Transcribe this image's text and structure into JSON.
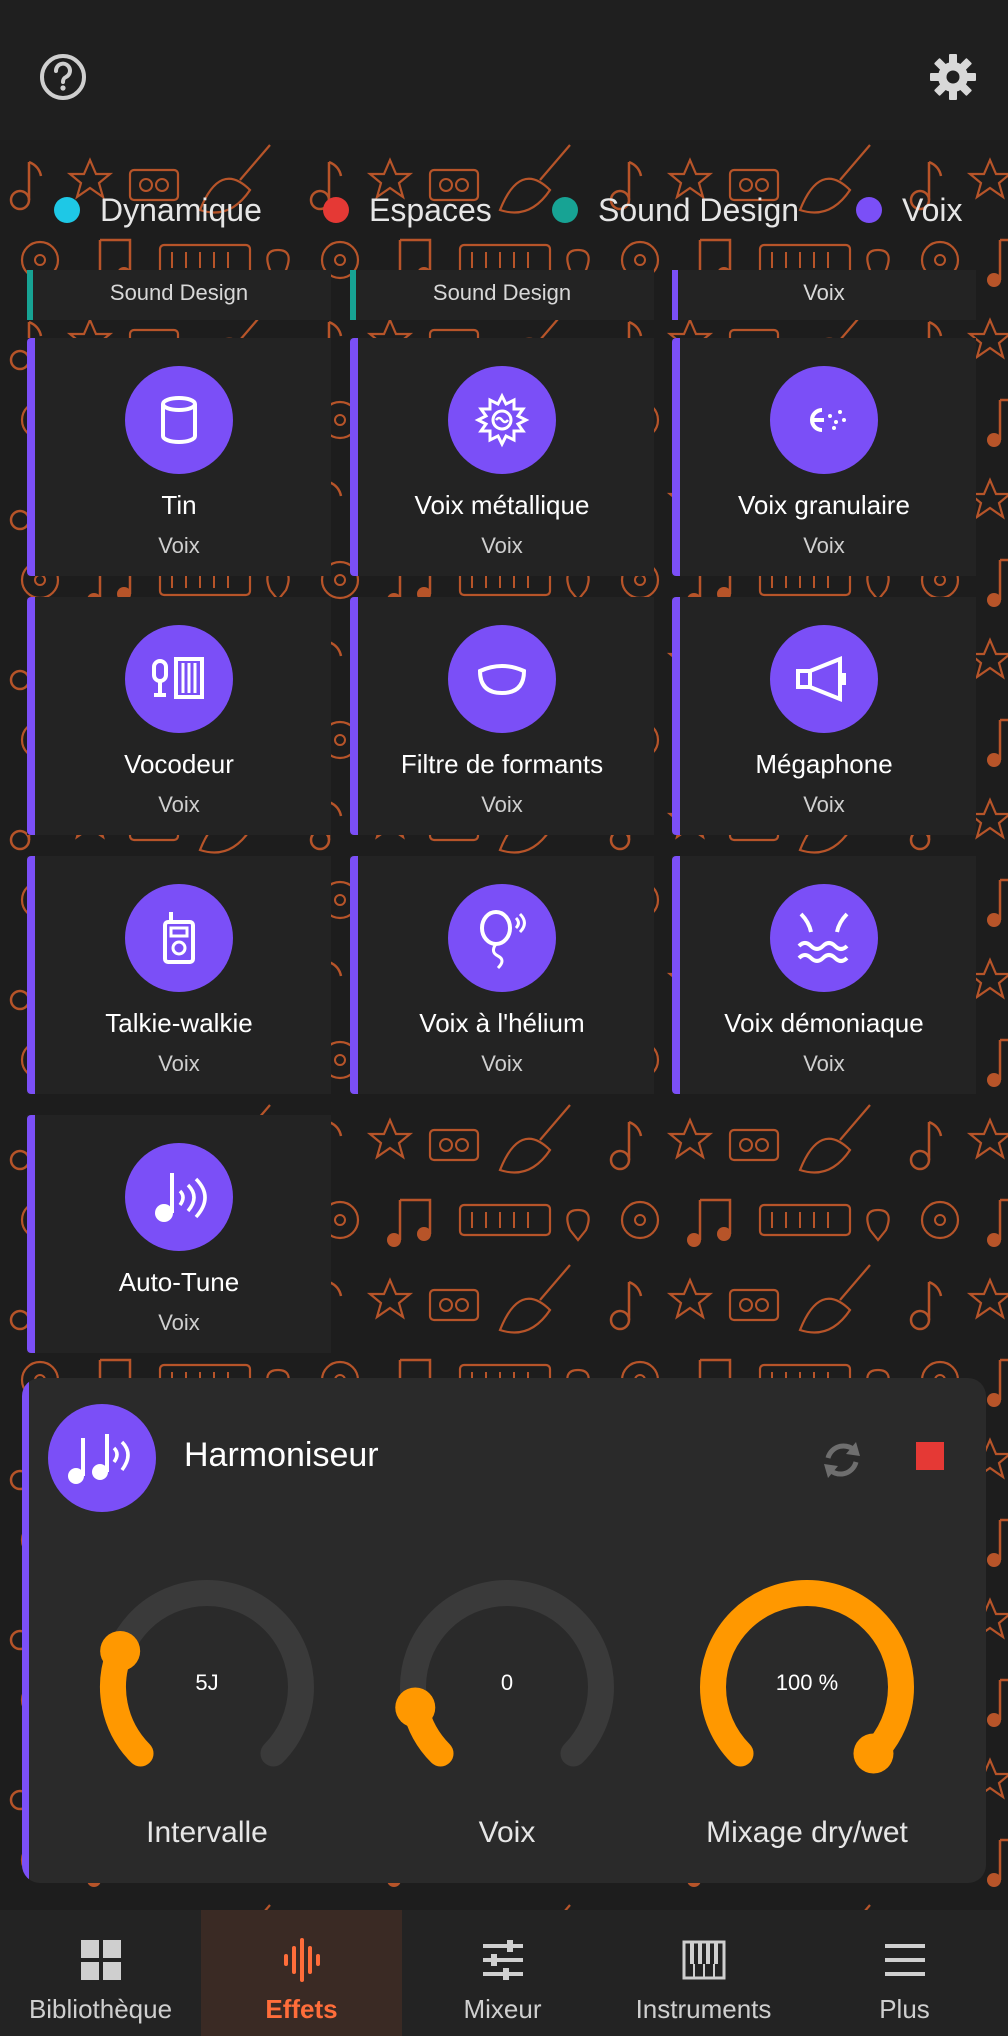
{
  "filters": [
    {
      "label": "Dynamique",
      "color": "#1ec8e6"
    },
    {
      "label": "Espaces",
      "color": "#e53935"
    },
    {
      "label": "Sound Design",
      "color": "#17a394"
    },
    {
      "label": "Voix",
      "color": "#7b4ff7"
    }
  ],
  "partial_cards": [
    {
      "label": "Sound Design",
      "color": "#17a394"
    },
    {
      "label": "Sound Design",
      "color": "#17a394"
    },
    {
      "label": "Voix",
      "color": "#7b4ff7"
    }
  ],
  "effects": [
    {
      "title": "Tin",
      "category": "Voix",
      "icon": "tin-can-icon"
    },
    {
      "title": "Voix métallique",
      "category": "Voix",
      "icon": "metallic-gear-icon"
    },
    {
      "title": "Voix granulaire",
      "category": "Voix",
      "icon": "granular-icon"
    },
    {
      "title": "Vocodeur",
      "category": "Voix",
      "icon": "vocoder-icon"
    },
    {
      "title": "Filtre de formants",
      "category": "Voix",
      "icon": "mouth-icon"
    },
    {
      "title": "Mégaphone",
      "category": "Voix",
      "icon": "megaphone-icon"
    },
    {
      "title": "Talkie-walkie",
      "category": "Voix",
      "icon": "walkie-talkie-icon"
    },
    {
      "title": "Voix à l'hélium",
      "category": "Voix",
      "icon": "balloon-icon"
    },
    {
      "title": "Voix démoniaque",
      "category": "Voix",
      "icon": "demon-face-icon"
    },
    {
      "title": "Auto-Tune",
      "category": "Voix",
      "icon": "autotune-note-icon"
    }
  ],
  "panel": {
    "title": "Harmoniseur",
    "icon": "harmonizer-notes-icon",
    "knobs": [
      {
        "label": "Intervalle",
        "value": "5J",
        "fraction": 0.25
      },
      {
        "label": "Voix",
        "value": "0",
        "fraction": 0.12
      },
      {
        "label": "Mixage dry/wet",
        "value": "100 %",
        "fraction": 1.0
      }
    ]
  },
  "nav": [
    {
      "label": "Bibliothèque",
      "icon": "library-grid-icon",
      "active": false
    },
    {
      "label": "Effets",
      "icon": "effects-waveform-icon",
      "active": true
    },
    {
      "label": "Mixeur",
      "icon": "mixer-sliders-icon",
      "active": false
    },
    {
      "label": "Instruments",
      "icon": "instruments-piano-icon",
      "active": false
    },
    {
      "label": "Plus",
      "icon": "menu-icon",
      "active": false
    }
  ],
  "colors": {
    "accent": "#7b4ff7",
    "knob": "#ff9800",
    "active_nav": "#ff6d3a",
    "doodle": "#c85a2a"
  }
}
